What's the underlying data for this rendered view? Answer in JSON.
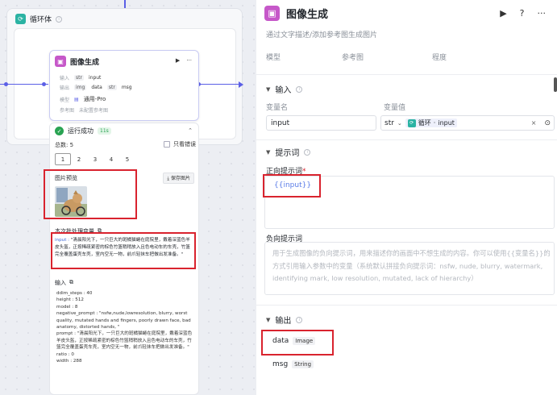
{
  "loop": {
    "title": "循环体"
  },
  "node": {
    "title": "图像生成",
    "rows": [
      {
        "key": "输入",
        "tags": [
          "str"
        ],
        "value": "input"
      },
      {
        "key": "输出",
        "tags": [
          "img",
          "str"
        ],
        "values": [
          "data",
          "msg"
        ]
      },
      {
        "key": "模型",
        "value": "通用-Pro"
      },
      {
        "key": "参考图",
        "value": "未配置参考图"
      }
    ]
  },
  "result": {
    "status": "运行成功",
    "duration": "11s",
    "total": "总数: 5",
    "only_errors": "只看错误",
    "pages": [
      "1",
      "2",
      "3",
      "4",
      "5"
    ],
    "preview_title": "图片预览",
    "save_image": "保存图片",
    "batch_title": "本次批处理变量",
    "batch_key": "input",
    "batch_text": "\"清晨阳光下，一只巨大的斑橘猫蜷在庭院里，戴着深蓝色羊皮头盔，正按稀疏紧密的棕色竹篮稍稍放入且色电动车的车壳，竹篮完全覆盖蛋壳车壳，室内空无一物，前爪轻抹车把做出发准备。\"",
    "input_title": "输入",
    "input_items": [
      "ddim_steps : 40",
      "height : 512",
      "model : 8",
      "negative_prompt : \"nsfw,nude,lowresolution, blurry, worst quality, mutated hands and fingers, poorly drawn face, bad anatomy, distorted hands, \"",
      "prompt : \"清晨阳光下，一只巨大的斑橘猫蜷在庭院里，戴着深蓝色羊皮头盔，正按稀疏紧密的棕色竹篮稍稍放入且色电动车的车壳，竹篮完全覆盖蛋壳车壳，室内空无一物，前爪轻抹车把做出发准备。\"",
      "ratio : 0",
      "width : 288"
    ]
  },
  "panel": {
    "title": "图像生成",
    "desc": "通过文字描述/添加参考图生成图片",
    "cols": [
      "模型",
      "参考图",
      "程度"
    ],
    "input_section": "输入",
    "var_name_label": "变量名",
    "var_value_label": "变量值",
    "var_name": "input",
    "var_type": "str",
    "var_ref_source": "循环",
    "var_ref_name": "input",
    "prompt_section": "提示词",
    "positive_label": "正向提示词",
    "positive_value": "{{input}}",
    "negative_label": "负向提示词",
    "negative_placeholder": "用于生成图像的负向提示词，用来描述你的画面中不想生成的内容。你可以使用{{变量名}}的方式引用输入参数中的变量（系统默认拼接负向提示词：nsfw, nude, blurry, watermark, identifying mark, low resolution, mutated, lack of hierarchy）",
    "output_section": "输出",
    "outputs": [
      {
        "name": "data",
        "type": "Image"
      },
      {
        "name": "msg",
        "type": "String"
      }
    ]
  },
  "colors": {
    "accent": "#5b5fe6",
    "highlight": "#d9232e",
    "success": "#29a352"
  }
}
